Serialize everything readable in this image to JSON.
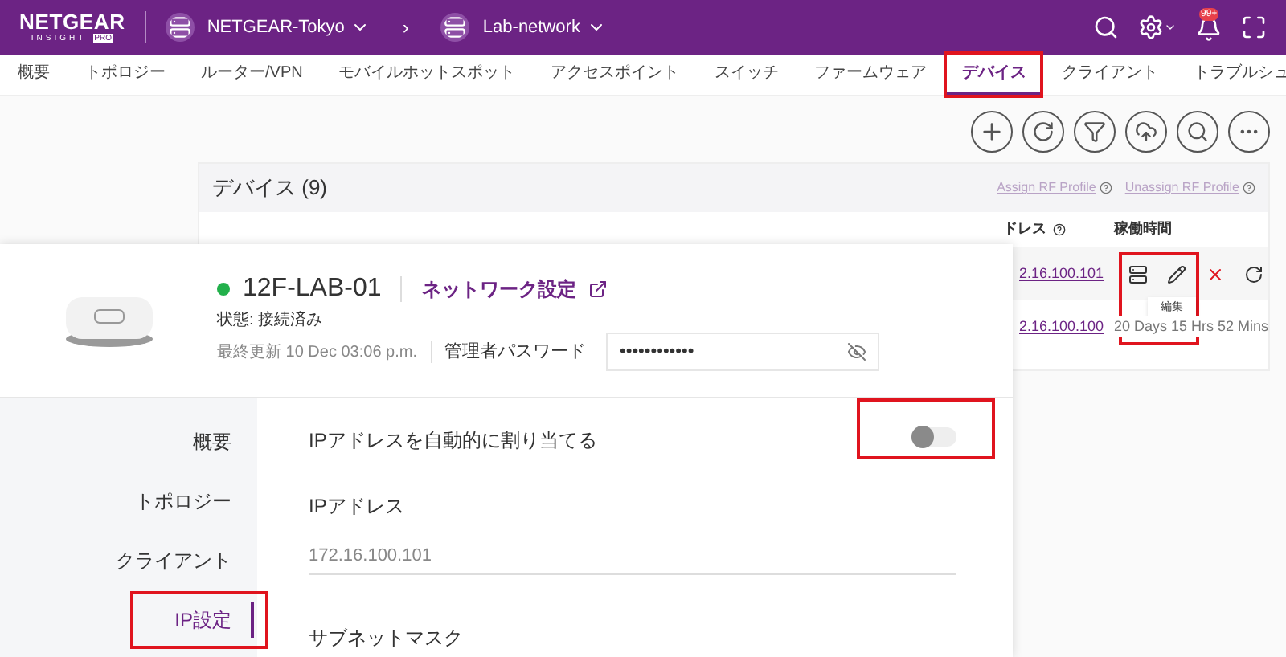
{
  "header": {
    "logo": "NETGEAR",
    "logo_sub": "INSIGHT",
    "logo_badge": "PRO",
    "org": "NETGEAR-Tokyo",
    "separator": "›",
    "network": "Lab-network",
    "notification_badge": "99+"
  },
  "tabs": [
    {
      "label": "概要",
      "selected": false
    },
    {
      "label": "トポロジー",
      "selected": false
    },
    {
      "label": "ルーター/VPN",
      "selected": false
    },
    {
      "label": "モバイルホットスポット",
      "selected": false
    },
    {
      "label": "アクセスポイント",
      "selected": false
    },
    {
      "label": "スイッチ",
      "selected": false
    },
    {
      "label": "ファームウェア",
      "selected": false
    },
    {
      "label": "デバイス",
      "selected": true
    },
    {
      "label": "クライアント",
      "selected": false
    },
    {
      "label": "トラブルシュ",
      "selected": false
    }
  ],
  "devices_panel": {
    "title": "デバイス (9)",
    "links": [
      "Assign RF Profile",
      "Unassign RF Profile"
    ],
    "columns": [
      "ドレス",
      "稼働時間"
    ],
    "rows": [
      {
        "kind": "actions",
        "ip": "2.16.100.101",
        "tooltip": "編集"
      },
      {
        "kind": "uptime",
        "ip": "2.16.100.100",
        "uptime": "20 Days 15 Hrs 52 Mins"
      }
    ]
  },
  "device": {
    "name": "12F-LAB-01",
    "online": true,
    "link": "ネットワーク設定",
    "status": "状態: 接続済み",
    "last_update": "最終更新 10 Dec 03:06 p.m.",
    "password_label": "管理者パスワード",
    "password": "••••••••••••"
  },
  "side_menu": [
    {
      "label": "概要",
      "selected": false
    },
    {
      "label": "トポロジー",
      "selected": false
    },
    {
      "label": "クライアント",
      "selected": false
    },
    {
      "label": "IP設定",
      "selected": true
    }
  ],
  "ip_settings": {
    "auto_label": "IPアドレスを自動的に割り当てる",
    "auto_on": false,
    "ip_label": "IPアドレス",
    "ip_value": "172.16.100.101",
    "subnet_label": "サブネットマスク"
  }
}
